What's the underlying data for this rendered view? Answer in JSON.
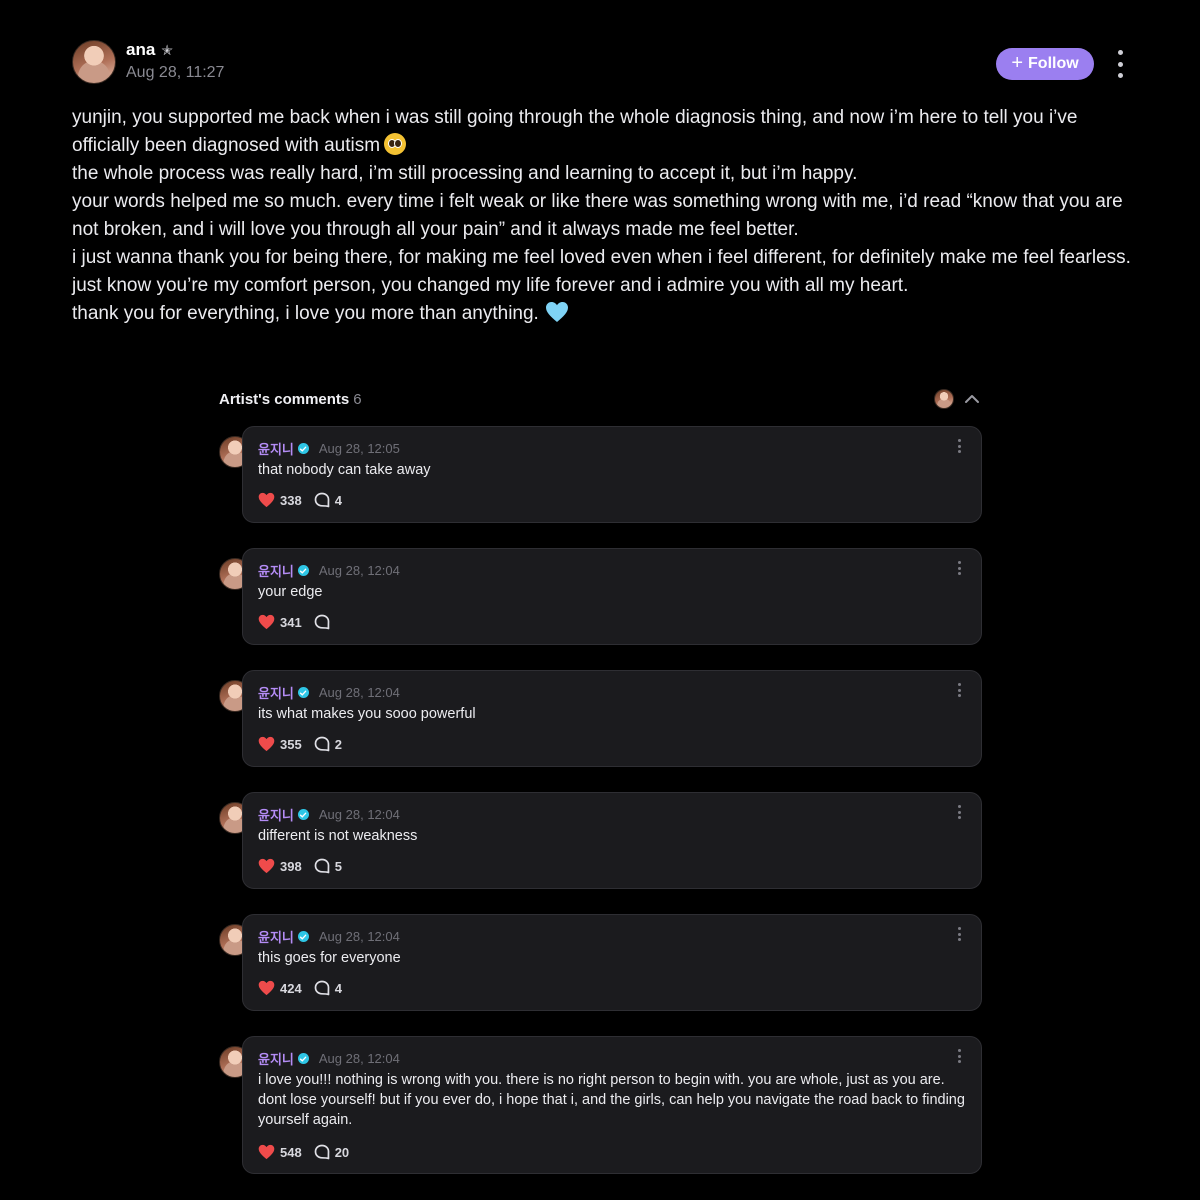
{
  "post": {
    "author": "ana",
    "time": "Aug 28, 11:27",
    "follow_label": "Follow",
    "lines": [
      "yunjin, you supported me back when i was still going through the whole diagnosis thing, and now i’m here to tell you i’ve officially been diagnosed with autism",
      "the whole process was really hard, i’m still processing and learning to accept it, but i’m happy.",
      "your words helped me so much. every time i felt weak or like there was something wrong with me, i’d read “know that you are not broken, and i will love you through all your pain” and it always made me feel better.",
      "i just wanna thank you for being there, for making me feel loved even when i feel different, for definitely make me feel fearless.",
      "just know you’re my comfort person, you changed my life forever and i admire you with all my heart.",
      "thank you for everything, i love you more than anything."
    ]
  },
  "comments_section": {
    "title": "Artist's comments",
    "count": "6",
    "items": [
      {
        "author": "윤지니",
        "time": "Aug 28, 12:05",
        "text": "that nobody can take away",
        "likes": "338",
        "replies": "4"
      },
      {
        "author": "윤지니",
        "time": "Aug 28, 12:04",
        "text": "your edge",
        "likes": "341",
        "replies": ""
      },
      {
        "author": "윤지니",
        "time": "Aug 28, 12:04",
        "text": "its what makes you sooo powerful",
        "likes": "355",
        "replies": "2"
      },
      {
        "author": "윤지니",
        "time": "Aug 28, 12:04",
        "text": "different is not weakness",
        "likes": "398",
        "replies": "5"
      },
      {
        "author": "윤지니",
        "time": "Aug 28, 12:04",
        "text": "this goes for everyone",
        "likes": "424",
        "replies": "4"
      },
      {
        "author": "윤지니",
        "time": "Aug 28, 12:04",
        "text": "i love you!!! nothing is wrong with you. there is no right person to begin with. you are whole, just as you are. dont lose yourself! but if you ever do, i hope that i, and the girls, can help you navigate the road back to finding yourself again.",
        "likes": "548",
        "replies": "20"
      }
    ]
  },
  "colors": {
    "background": "#000000",
    "follow_button": "#9b7ff0",
    "artist_name": "#b48cf5",
    "verified_badge": "#2ec6e6",
    "heart": "#ef4b4b",
    "card": "#1b1b1e"
  },
  "icons": [
    "star-icon",
    "plus-icon",
    "more-icon",
    "pleading-face-emoji",
    "blue-heart-emoji",
    "chevron-up-icon",
    "verified-icon",
    "heart-icon",
    "comment-bubble-icon"
  ]
}
